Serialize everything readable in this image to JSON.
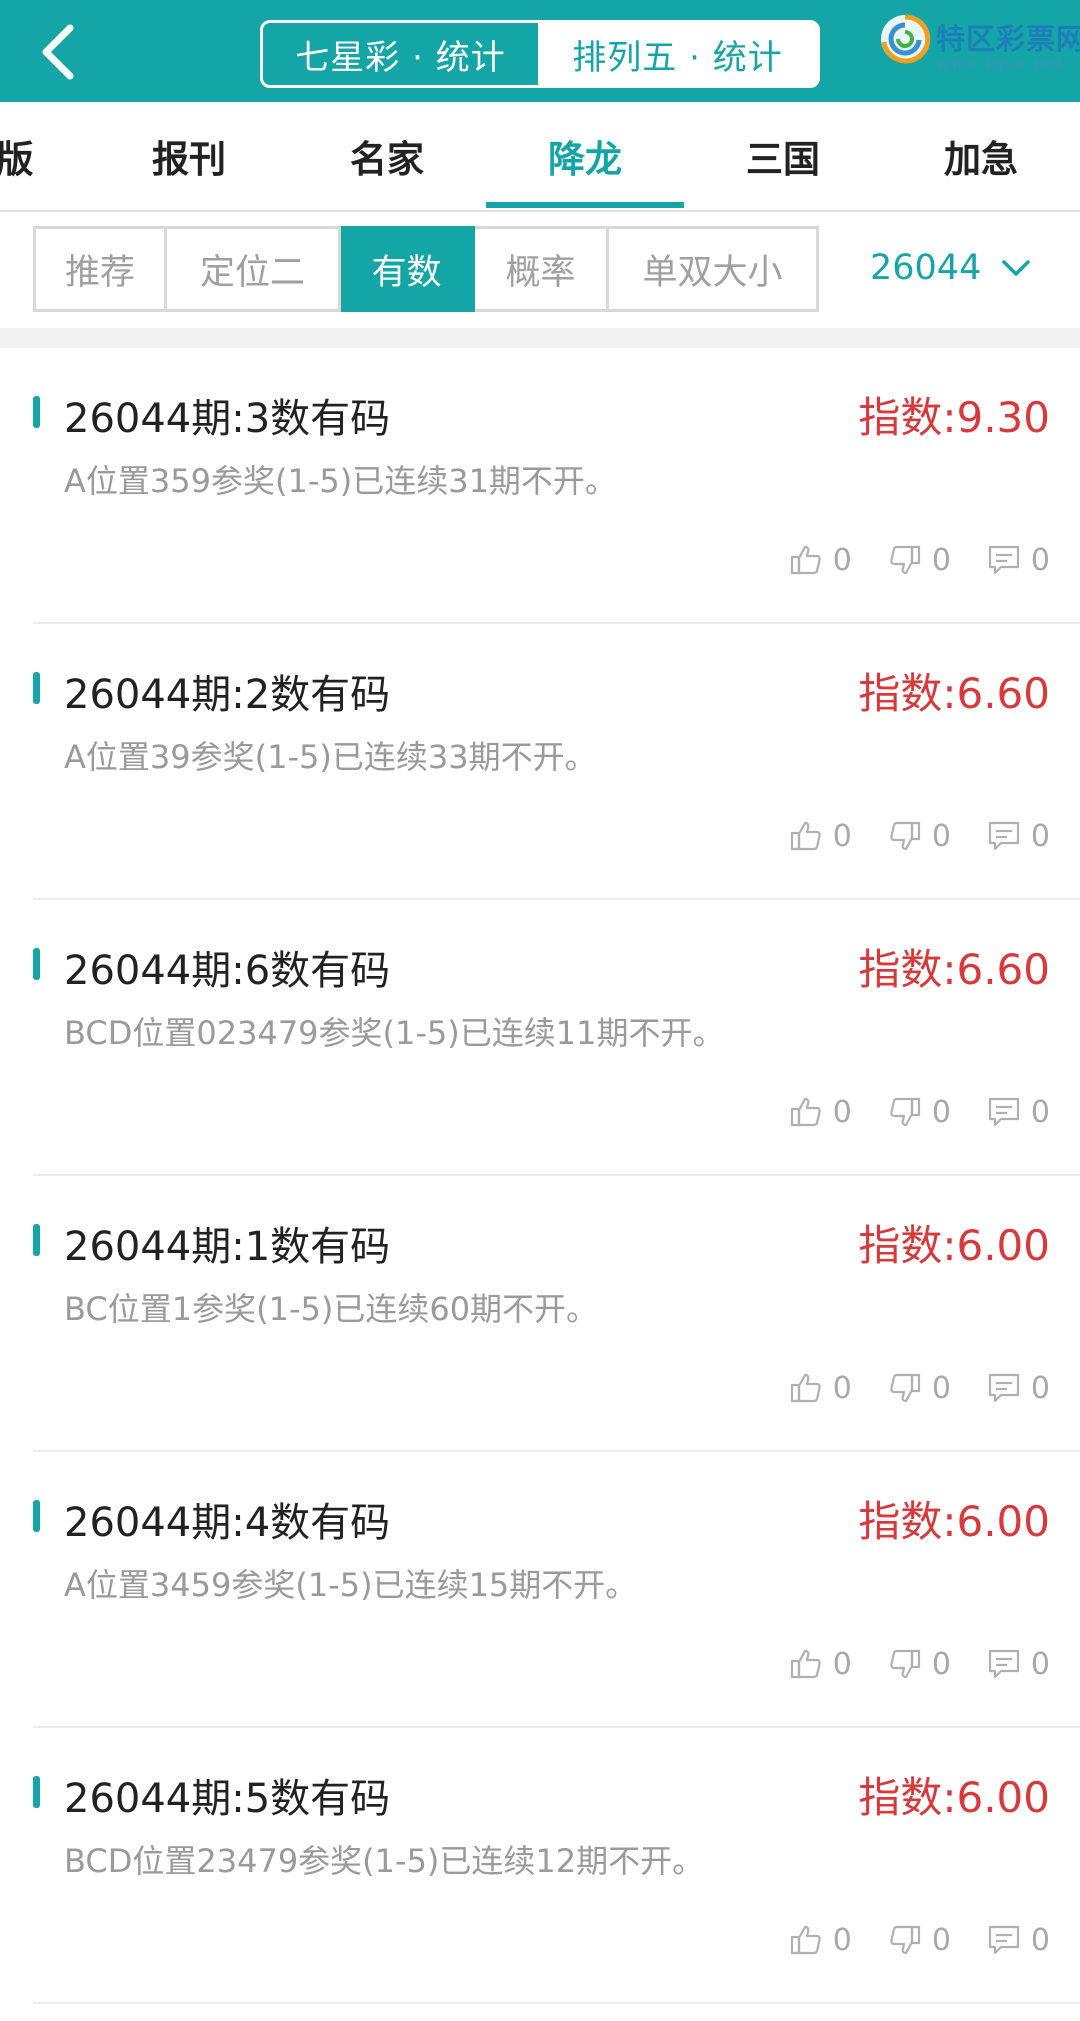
{
  "header": {
    "seg_left": "七星彩 · 统计",
    "seg_right": "排列五 · 统计",
    "logo_title": "特区彩票网",
    "logo_url": "www.tqcp.net"
  },
  "colors": {
    "accent": "#14a6a6",
    "index_red": "#d9393a",
    "muted": "#9a9a9a"
  },
  "tabs": [
    {
      "label": "版"
    },
    {
      "label": "报刊"
    },
    {
      "label": "名家"
    },
    {
      "label": "降龙",
      "active": true
    },
    {
      "label": "三国"
    },
    {
      "label": "加急"
    }
  ],
  "filters": [
    {
      "label": "推荐"
    },
    {
      "label": "定位二"
    },
    {
      "label": "有数",
      "active": true
    },
    {
      "label": "概率"
    },
    {
      "label": "单双大小"
    }
  ],
  "period": "26044",
  "items": [
    {
      "title": "26044期:3数有码",
      "index": "指数:9.30",
      "desc": "A位置359参奖(1-5)已连续31期不开。",
      "likes": "0",
      "dislikes": "0",
      "comments": "0"
    },
    {
      "title": "26044期:2数有码",
      "index": "指数:6.60",
      "desc": "A位置39参奖(1-5)已连续33期不开。",
      "likes": "0",
      "dislikes": "0",
      "comments": "0"
    },
    {
      "title": "26044期:6数有码",
      "index": "指数:6.60",
      "desc": "BCD位置023479参奖(1-5)已连续11期不开。",
      "likes": "0",
      "dislikes": "0",
      "comments": "0"
    },
    {
      "title": "26044期:1数有码",
      "index": "指数:6.00",
      "desc": "BC位置1参奖(1-5)已连续60期不开。",
      "likes": "0",
      "dislikes": "0",
      "comments": "0"
    },
    {
      "title": "26044期:4数有码",
      "index": "指数:6.00",
      "desc": "A位置3459参奖(1-5)已连续15期不开。",
      "likes": "0",
      "dislikes": "0",
      "comments": "0"
    },
    {
      "title": "26044期:5数有码",
      "index": "指数:6.00",
      "desc": "BCD位置23479参奖(1-5)已连续12期不开。",
      "likes": "0",
      "dislikes": "0",
      "comments": "0"
    }
  ]
}
